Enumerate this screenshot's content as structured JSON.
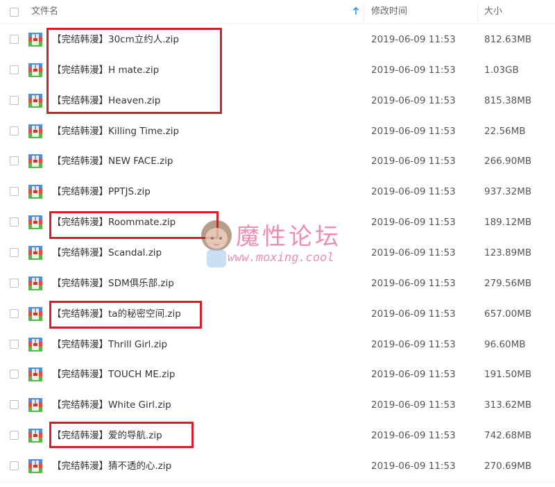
{
  "header": {
    "name_label": "文件名",
    "modified_label": "修改时间",
    "size_label": "大小",
    "sort_icon": "arrow-up-icon"
  },
  "files": [
    {
      "name": "【完结韩漫】30cm立约人.zip",
      "modified": "2019-06-09 11:53",
      "size": "812.63MB"
    },
    {
      "name": "【完结韩漫】H mate.zip",
      "modified": "2019-06-09 11:53",
      "size": "1.03GB"
    },
    {
      "name": "【完结韩漫】Heaven.zip",
      "modified": "2019-06-09 11:53",
      "size": "815.38MB"
    },
    {
      "name": "【完结韩漫】Killing Time.zip",
      "modified": "2019-06-09 11:53",
      "size": "22.56MB"
    },
    {
      "name": "【完结韩漫】NEW  FACE.zip",
      "modified": "2019-06-09 11:53",
      "size": "266.90MB"
    },
    {
      "name": "【完结韩漫】PPTJS.zip",
      "modified": "2019-06-09 11:53",
      "size": "937.32MB"
    },
    {
      "name": "【完结韩漫】Roommate.zip",
      "modified": "2019-06-09 11:53",
      "size": "189.12MB"
    },
    {
      "name": "【完结韩漫】Scandal.zip",
      "modified": "2019-06-09 11:53",
      "size": "123.89MB"
    },
    {
      "name": "【完结韩漫】SDM俱乐部.zip",
      "modified": "2019-06-09 11:53",
      "size": "279.56MB"
    },
    {
      "name": "【完结韩漫】ta的秘密空间.zip",
      "modified": "2019-06-09 11:53",
      "size": "657.00MB"
    },
    {
      "name": "【完结韩漫】Thrill Girl.zip",
      "modified": "2019-06-09 11:53",
      "size": "96.60MB"
    },
    {
      "name": "【完结韩漫】TOUCH ME.zip",
      "modified": "2019-06-09 11:53",
      "size": "191.50MB"
    },
    {
      "name": "【完结韩漫】White Girl.zip",
      "modified": "2019-06-09 11:53",
      "size": "313.62MB"
    },
    {
      "name": "【完结韩漫】爱的导航.zip",
      "modified": "2019-06-09 11:53",
      "size": "742.68MB"
    },
    {
      "name": "【完结韩漫】猜不透的心.zip",
      "modified": "2019-06-09 11:53",
      "size": "270.69MB"
    }
  ],
  "file_icon": "zip-archive-icon",
  "watermark": {
    "title": "魔性论坛",
    "url": "www.moxing.cool"
  },
  "colors": {
    "highlight_border": "#d91e2a",
    "watermark": "#f08cb4",
    "sort_arrow": "#2a8ff7"
  }
}
